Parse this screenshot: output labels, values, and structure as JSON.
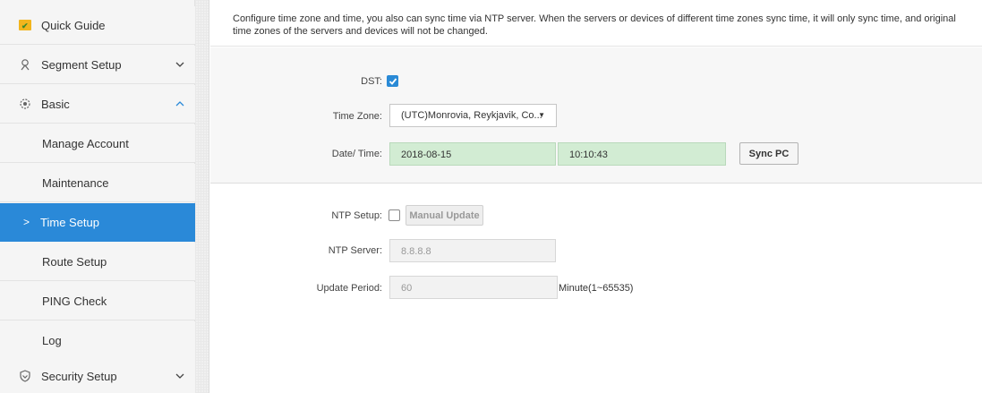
{
  "sidebar": {
    "items": [
      {
        "label": "Quick Guide",
        "icon": "quick-guide-icon"
      },
      {
        "label": "Segment Setup",
        "icon": "segment-icon"
      },
      {
        "label": "Basic",
        "icon": "basic-icon"
      },
      {
        "label": "Manage Account"
      },
      {
        "label": "Maintenance"
      },
      {
        "label": "Time Setup"
      },
      {
        "label": "Route Setup"
      },
      {
        "label": "PING Check"
      },
      {
        "label": "Log"
      },
      {
        "label": "Security Setup",
        "icon": "security-icon"
      }
    ],
    "active": "Time Setup",
    "accent": "#2a89d8"
  },
  "notice": "Configure time zone and time, you also can sync time via NTP server. When the servers or devices of different time zones sync time, it will only sync time, and original time zones of the servers and devices will not be changed.",
  "time": {
    "dst_label": "DST:",
    "dst_checked": true,
    "timezone_label": "Time Zone:",
    "timezone_value": "(UTC)Monrovia, Reykjavik, Co...",
    "datetime_label": "Date/ Time:",
    "date_value": "2018-08-15",
    "time_value": "10:10:43",
    "sync_pc_label": "Sync PC"
  },
  "ntp": {
    "setup_label": "NTP Setup:",
    "setup_checked": false,
    "manual_update_label": "Manual Update",
    "server_label": "NTP Server:",
    "server_value": "8.8.8.8",
    "period_label": "Update Period:",
    "period_value": "60",
    "period_unit": "Minute(1~65535)"
  }
}
